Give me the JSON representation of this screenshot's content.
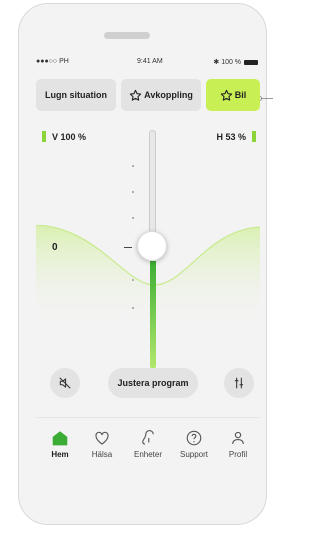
{
  "status_bar": {
    "carrier": "●●●○○ PH",
    "time": "9:41 AM",
    "battery": "100 %"
  },
  "programs": [
    {
      "label": "Lugn situation",
      "icon": "none",
      "selected": false
    },
    {
      "label": "Avkoppling",
      "icon": "star-outline-icon",
      "selected": false
    },
    {
      "label": "Bil",
      "icon": "star-outline-icon",
      "selected": true
    }
  ],
  "volume": {
    "left_label": "V 100 %",
    "right_label": "H 53 %"
  },
  "slider": {
    "value_label": "0"
  },
  "controls": {
    "adjust_label": "Justera program"
  },
  "nav": [
    {
      "label": "Hem",
      "icon": "home-icon",
      "active": true
    },
    {
      "label": "Hälsa",
      "icon": "heart-icon",
      "active": false
    },
    {
      "label": "Enheter",
      "icon": "hearing-aid-icon",
      "active": false
    },
    {
      "label": "Support",
      "icon": "help-icon",
      "active": false
    },
    {
      "label": "Profil",
      "icon": "profile-icon",
      "active": false
    }
  ],
  "colors": {
    "accent": "#c8f055",
    "green": "#5cc33c",
    "active_nav": "#3cad34"
  }
}
